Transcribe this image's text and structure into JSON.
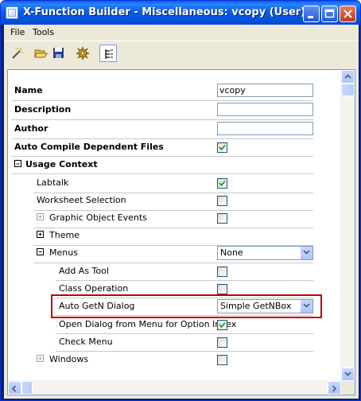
{
  "window": {
    "title": "X-Function Builder - Miscellaneous: vcopy (User)"
  },
  "menu": {
    "items": [
      "File",
      "Tools"
    ]
  },
  "toolbar": {
    "buttons": [
      "new-wand-icon",
      "open-folder-icon",
      "save-disk-icon",
      "settings-gear-icon",
      "tree-view-icon"
    ]
  },
  "properties": {
    "name_label": "Name",
    "name_value": "vcopy",
    "description_label": "Description",
    "description_value": "",
    "author_label": "Author",
    "author_value": "",
    "auto_compile_label": "Auto Compile Dependent Files",
    "auto_compile_checked": true,
    "usage_context_label": "Usage Context",
    "labtalk_label": "Labtalk",
    "labtalk_checked": true,
    "worksheet_selection_label": "Worksheet Selection",
    "worksheet_selection_checked": false,
    "graphic_object_events_label": "Graphic Object Events",
    "graphic_object_events_checked": false,
    "theme_label": "Theme",
    "menus_label": "Menus",
    "menus_value": "None",
    "add_as_tool_label": "Add As Tool",
    "add_as_tool_checked": false,
    "class_operation_label": "Class Operation",
    "class_operation_checked": false,
    "auto_getn_label": "Auto GetN Dialog",
    "auto_getn_value": "Simple GetNBox",
    "open_dialog_label": "Open Dialog from Menu for Option Index",
    "open_dialog_checked": true,
    "check_menu_label": "Check Menu",
    "check_menu_checked": false,
    "windows_label": "Windows",
    "windows_checked": false
  },
  "colors": {
    "titlebar": "#0a5ee8",
    "highlight_border": "#c00000",
    "check_green": "#21a121"
  }
}
